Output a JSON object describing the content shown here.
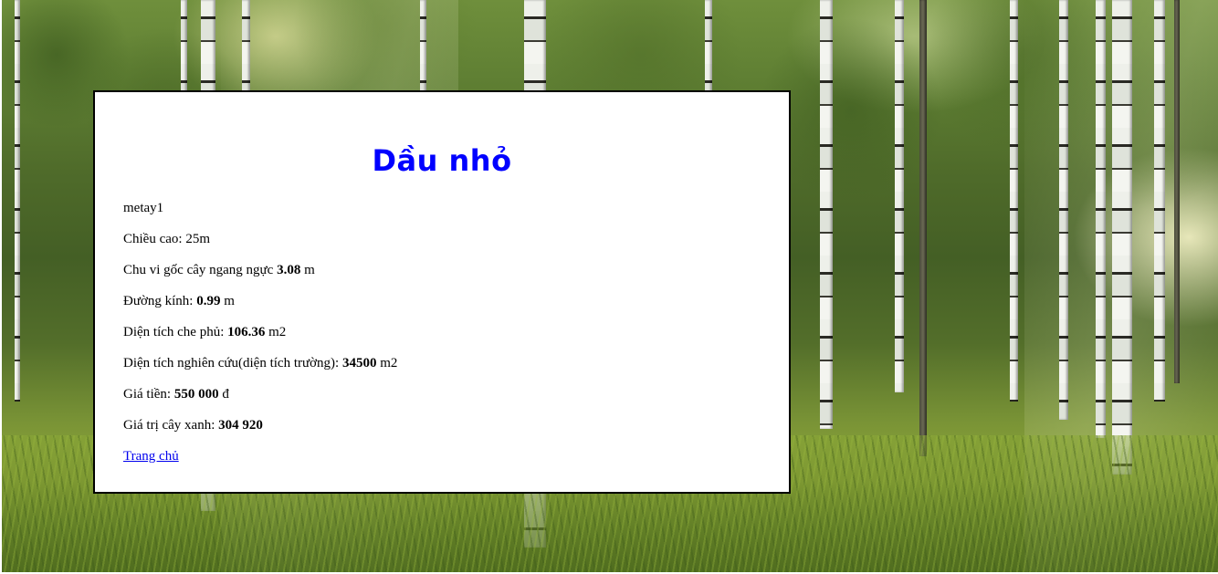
{
  "page": {
    "title": "Dầu nhỏ",
    "code": "metay1",
    "height": {
      "label": "Chiều cao: ",
      "value": "25m"
    },
    "circumference": {
      "label": "Chu vi gốc cây ngang ngực ",
      "value": "3.08",
      "unit": " m"
    },
    "diameter": {
      "label": "Đường kính: ",
      "value": "0.99",
      "unit": " m"
    },
    "canopy_area": {
      "label": "Diện tích che phủ: ",
      "value": "106.36",
      "unit": " m2"
    },
    "study_area": {
      "label": "Diện tích nghiên cứu(diện tích trường): ",
      "value": "34500",
      "unit": " m2"
    },
    "price": {
      "label": "Giá tiền: ",
      "value": "550 000",
      "unit": " đ"
    },
    "green_value": {
      "label": "Giá trị cây xanh: ",
      "value": "304 920"
    },
    "home_link": "Trang chủ"
  },
  "colors": {
    "title": "#0000ff",
    "link": "#0000ee",
    "panel_border": "#000000"
  }
}
